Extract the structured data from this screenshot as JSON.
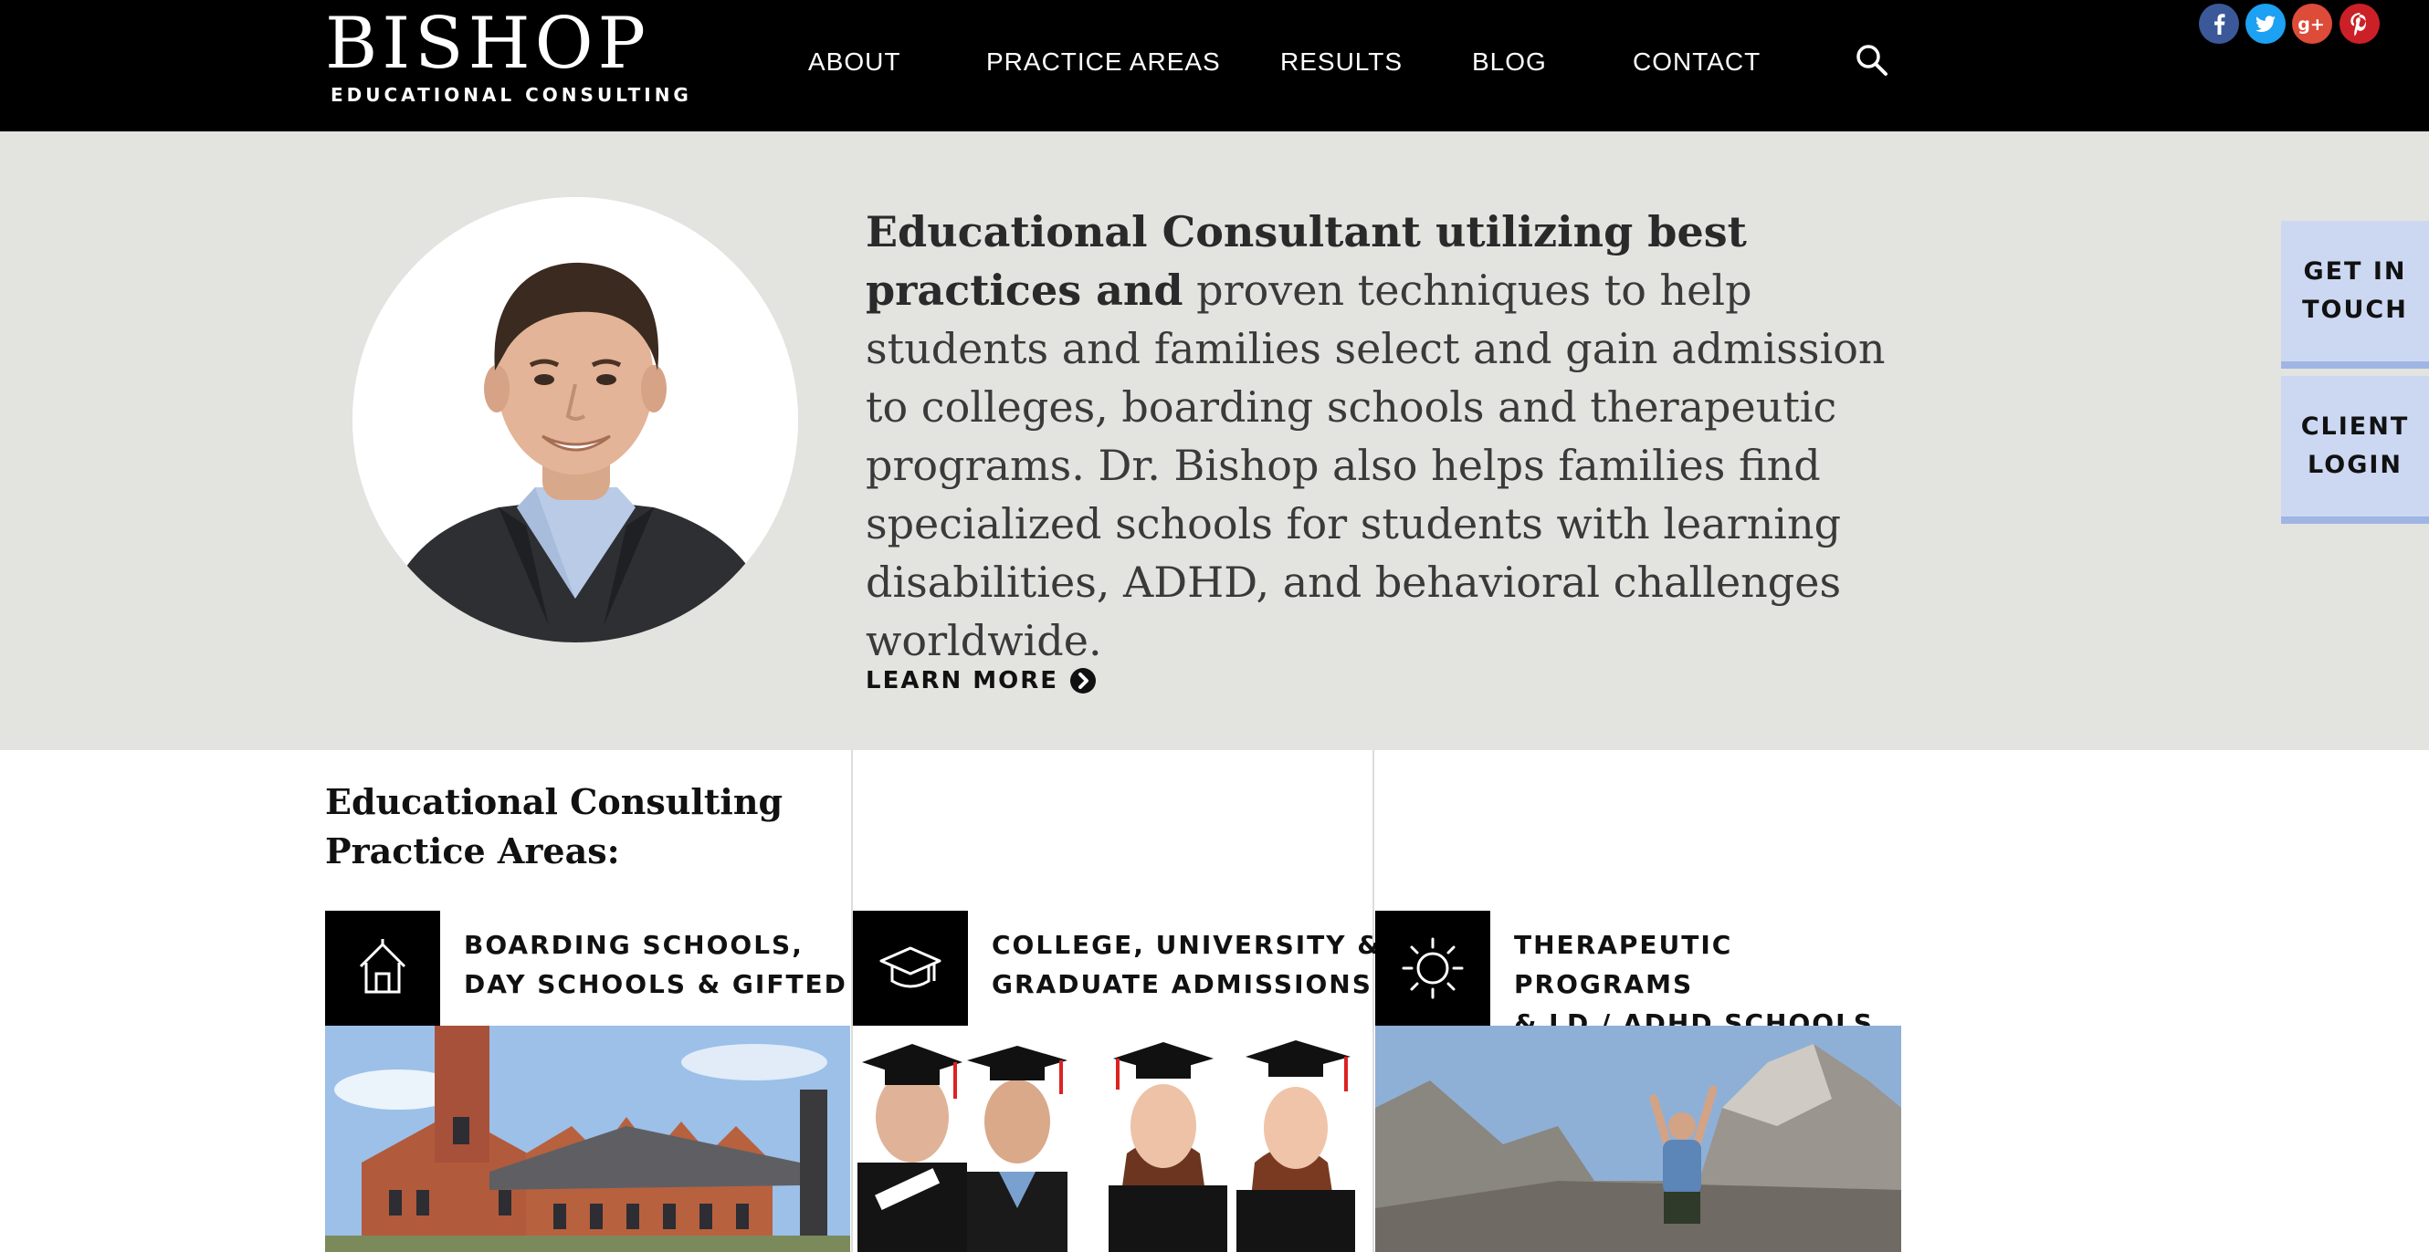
{
  "header": {
    "logo_word": "BISHOP",
    "logo_sub": "EDUCATIONAL CONSULTING",
    "nav": [
      "ABOUT",
      "PRACTICE AREAS",
      "RESULTS",
      "BLOG",
      "CONTACT"
    ]
  },
  "social": [
    "facebook-icon",
    "twitter-icon",
    "google-plus-icon",
    "pinterest-icon"
  ],
  "hero": {
    "lead_bold": "Educational Consultant utilizing best practices and",
    "lead_rest": "proven techniques to help students and families select and gain admission to colleges, boarding schools and therapeutic programs. Dr. Bishop also helps families find specialized schools for students with learning disabilities, ADHD, and behavioral challenges worldwide.",
    "learn_more": "LEARN MORE"
  },
  "side_tabs": {
    "get_in_touch": "GET IN TOUCH",
    "client_login": "CLIENT LOGIN"
  },
  "practice": {
    "title": "Educational Consulting Practice Areas:",
    "cards": [
      {
        "line1": "BOARDING SCHOOLS,",
        "line2": "DAY SCHOOLS & GIFTED",
        "icon": "house-icon"
      },
      {
        "line1": "COLLEGE, UNIVERSITY &",
        "line2": "GRADUATE ADMISSIONS",
        "icon": "graduation-cap-icon"
      },
      {
        "line1": "THERAPEUTIC PROGRAMS",
        "line2": "& LD / ADHD SCHOOLS",
        "icon": "sun-icon"
      }
    ]
  },
  "colors": {
    "header_bg": "#000000",
    "hero_bg": "#e3e3df",
    "side_tab_bg": "#ccd8f2",
    "facebook": "#3b5998",
    "twitter": "#1da1f2",
    "google_plus": "#dd4b39",
    "pinterest": "#cb2027"
  }
}
